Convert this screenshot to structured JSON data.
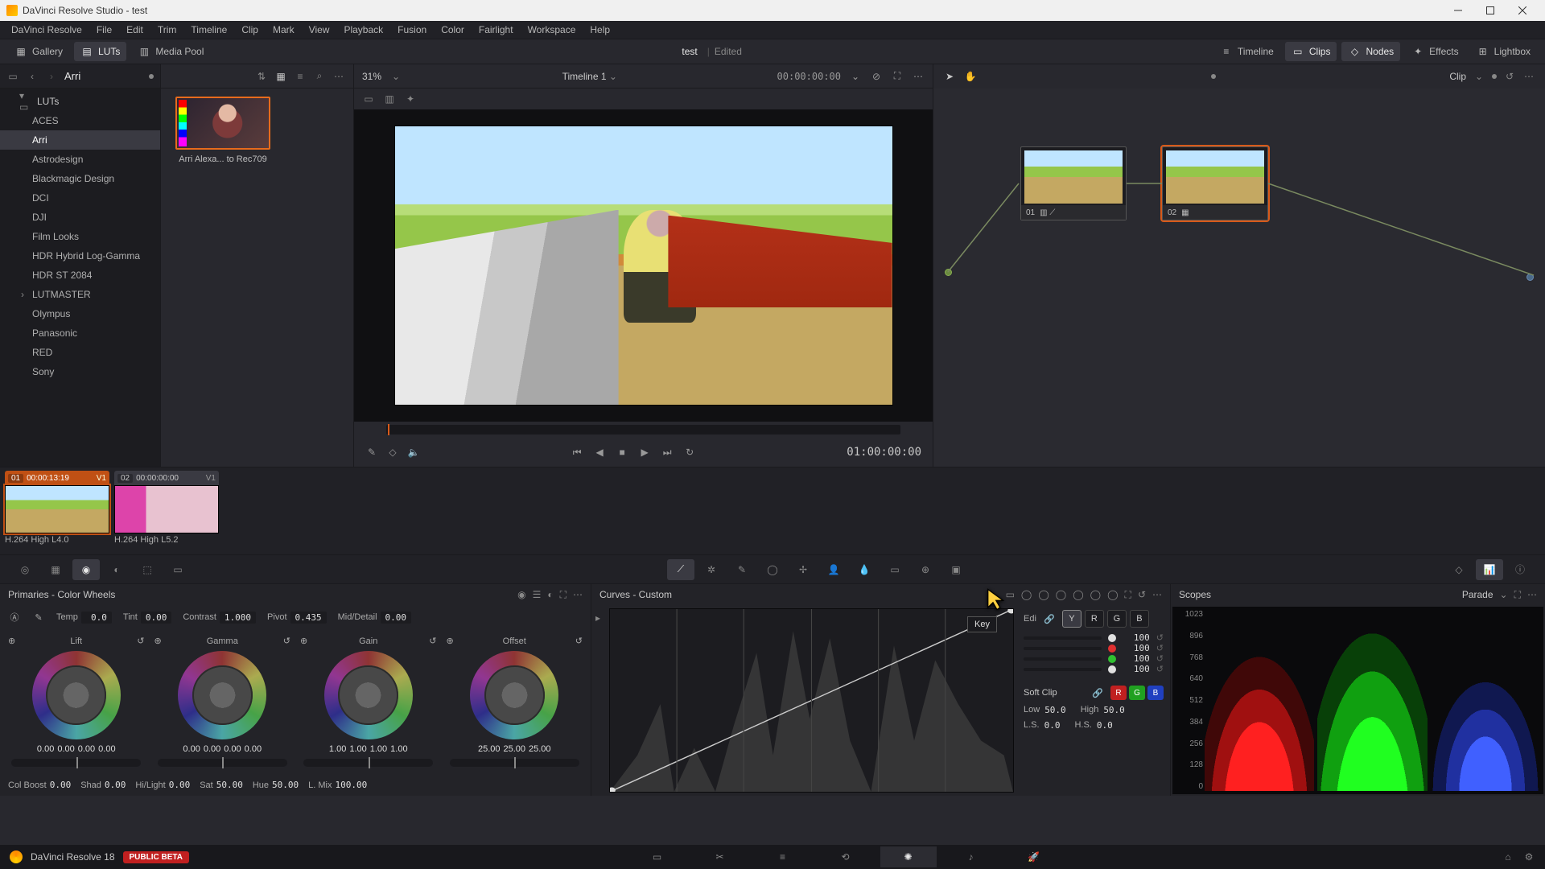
{
  "window": {
    "title": "DaVinci Resolve Studio - test"
  },
  "menubar": [
    "DaVinci Resolve",
    "File",
    "Edit",
    "Trim",
    "Timeline",
    "Clip",
    "Mark",
    "View",
    "Playback",
    "Fusion",
    "Color",
    "Fairlight",
    "Workspace",
    "Help"
  ],
  "toptool": {
    "gallery": "Gallery",
    "luts": "LUTs",
    "mediapool": "Media Pool",
    "doc_title": "test",
    "doc_status": "Edited",
    "timeline": "Timeline",
    "clips": "Clips",
    "nodes": "Nodes",
    "effects": "Effects",
    "lightbox": "Lightbox"
  },
  "luts_panel": {
    "root": "LUTs",
    "folders": [
      "ACES",
      "Arri",
      "Astrodesign",
      "Blackmagic Design",
      "DCI",
      "DJI",
      "Film Looks",
      "HDR Hybrid Log-Gamma",
      "HDR ST 2084",
      "LUTMASTER",
      "Olympus",
      "Panasonic",
      "RED",
      "Sony"
    ],
    "selected_index": 1,
    "expandable_index": 9,
    "current": "Arri",
    "zoom": "31%",
    "thumb_caption": "Arri Alexa... to Rec709"
  },
  "viewer": {
    "timeline_name": "Timeline 1",
    "record_tc": "00:00:00:00",
    "play_tc": "01:00:00:00"
  },
  "nodes": {
    "mode": "Clip",
    "items": [
      {
        "num": "01",
        "icons": "▥ ⟋"
      },
      {
        "num": "02",
        "icons": "▦"
      }
    ]
  },
  "clips": [
    {
      "num": "01",
      "tc": "00:00:13:19",
      "track": "V1",
      "name": "H.264 High L4.0",
      "selected": true
    },
    {
      "num": "02",
      "tc": "00:00:00:00",
      "track": "V1",
      "name": "H.264 High L5.2",
      "selected": false
    }
  ],
  "wheels": {
    "title": "Primaries - Color Wheels",
    "row1": {
      "temp_l": "Temp",
      "temp_v": "0.0",
      "tint_l": "Tint",
      "tint_v": "0.00",
      "contrast_l": "Contrast",
      "contrast_v": "1.000",
      "pivot_l": "Pivot",
      "pivot_v": "0.435",
      "md_l": "Mid/Detail",
      "md_v": "0.00"
    },
    "cells": [
      {
        "name": "Lift",
        "vals": [
          "0.00",
          "0.00",
          "0.00",
          "0.00"
        ]
      },
      {
        "name": "Gamma",
        "vals": [
          "0.00",
          "0.00",
          "0.00",
          "0.00"
        ]
      },
      {
        "name": "Gain",
        "vals": [
          "1.00",
          "1.00",
          "1.00",
          "1.00"
        ]
      },
      {
        "name": "Offset",
        "vals": [
          "25.00",
          "25.00",
          "25.00"
        ]
      }
    ],
    "row2": {
      "cb_l": "Col Boost",
      "cb_v": "0.00",
      "shad_l": "Shad",
      "shad_v": "0.00",
      "hl_l": "Hi/Light",
      "hl_v": "0.00",
      "sat_l": "Sat",
      "sat_v": "50.00",
      "hue_l": "Hue",
      "hue_v": "50.00",
      "lmix_l": "L. Mix",
      "lmix_v": "100.00"
    }
  },
  "curves": {
    "title": "Curves - Custom",
    "edit_label": "Edi",
    "channels": [
      "Y",
      "R",
      "G",
      "B"
    ],
    "sliders": [
      {
        "color": "#e0e0e0",
        "val": "100"
      },
      {
        "color": "#e03030",
        "val": "100"
      },
      {
        "color": "#30c030",
        "val": "100"
      },
      {
        "color": "#e0e0e0",
        "val": "100"
      }
    ],
    "softclip": "Soft Clip",
    "sc": {
      "low_l": "Low",
      "low_v": "50.0",
      "high_l": "High",
      "high_v": "50.0",
      "ls_l": "L.S.",
      "ls_v": "0.0",
      "hs_l": "H.S.",
      "hs_v": "0.0"
    }
  },
  "scopes": {
    "title": "Scopes",
    "mode": "Parade",
    "ticks": [
      "1023",
      "896",
      "768",
      "640",
      "512",
      "384",
      "256",
      "128",
      "0"
    ]
  },
  "tooltip": "Key",
  "footer": {
    "app": "DaVinci Resolve 18",
    "beta": "PUBLIC BETA"
  }
}
